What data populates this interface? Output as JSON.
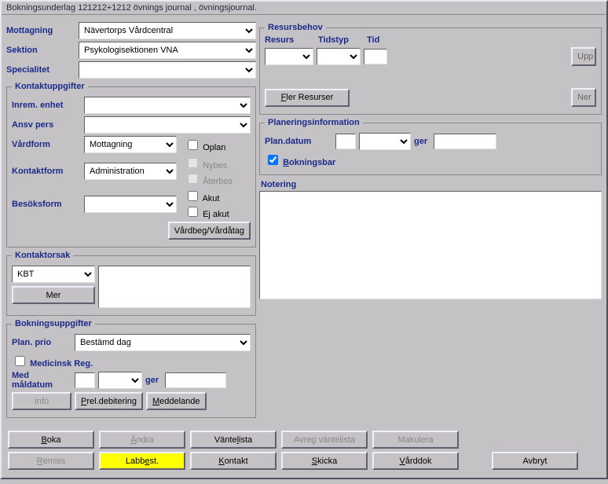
{
  "titlebar": "Bokningsunderlag 121212+1212 övnings journal , övningsjournal.",
  "top": {
    "mottagning_label": "Mottagning",
    "mottagning_value": "Nävertorps Vårdcentral",
    "sektion_label": "Sektion",
    "sektion_value": "Psykologisektionen VNA",
    "specialitet_label": "Specialitet",
    "specialitet_value": ""
  },
  "kontaktuppgifter": {
    "legend": "Kontaktuppgifter",
    "inrem_enhet_label": "Inrem. enhet",
    "inrem_enhet_value": "",
    "ansv_pers_label": "Ansv pers",
    "ansv_pers_value": "",
    "vardform_label": "Vårdform",
    "vardform_value": "Mottagning",
    "kontaktform_label": "Kontaktform",
    "kontaktform_value": "Administration",
    "besoksform_label": "Besöksform",
    "besoksform_value": "",
    "oplan": "Oplan",
    "nybes": "Nybes",
    "aterbes": "Återbes",
    "akut": "Akut",
    "ej_akut": "Ej akut",
    "vardbeg_btn": "Vårdbeg/Vårdåtag"
  },
  "kontaktorsak": {
    "legend": "Kontaktorsak",
    "select_value": "KBT",
    "mer_btn": "Mer",
    "text": ""
  },
  "bokningsuppgifter": {
    "legend": "Bokningsuppgifter",
    "plan_prio_label": "Plan. prio",
    "plan_prio_value": "Bestämd dag",
    "medicinsk_reg": "Medicinsk Reg.",
    "med_maldatum_label_1": "Med",
    "med_maldatum_label_2": "måldatum",
    "med_maldatum_value": "",
    "maldatum_select": "",
    "ger_label": "ger",
    "ger_value": "",
    "info_btn": "Info",
    "prel_debitering_btn": "Prel.debitering",
    "meddelande_btn": "Meddelande"
  },
  "resursbehov": {
    "legend": "Resursbehov",
    "resurs_header": "Resurs",
    "tidstyp_header": "Tidstyp",
    "tid_header": "Tid",
    "resurs_value": "",
    "tidstyp_value": "",
    "tid_value": "",
    "upp_btn": "Upp",
    "fler_resurser_btn": "Fler Resurser",
    "ner_btn": "Ner"
  },
  "planering": {
    "legend": "Planeringsinformation",
    "plan_datum_label": "Plan.datum",
    "plan_datum_value": "",
    "plan_datum_select": "",
    "ger_label": "ger",
    "ger_value": "",
    "bokningsbar": "Bokningsbar"
  },
  "notering": {
    "label": "Notering",
    "value": ""
  },
  "buttons": {
    "boka": "Boka",
    "andra": "Ändra",
    "vantelista": "Väntelista",
    "avreg_vantelista": "Avreg väntelista",
    "makulera": "Makulera",
    "remiss": "Remiss",
    "labbest": "Labbest.",
    "kontakt": "Kontakt",
    "skicka": "Skicka",
    "varddok": "Vårddok",
    "avbryt": "Avbryt"
  }
}
